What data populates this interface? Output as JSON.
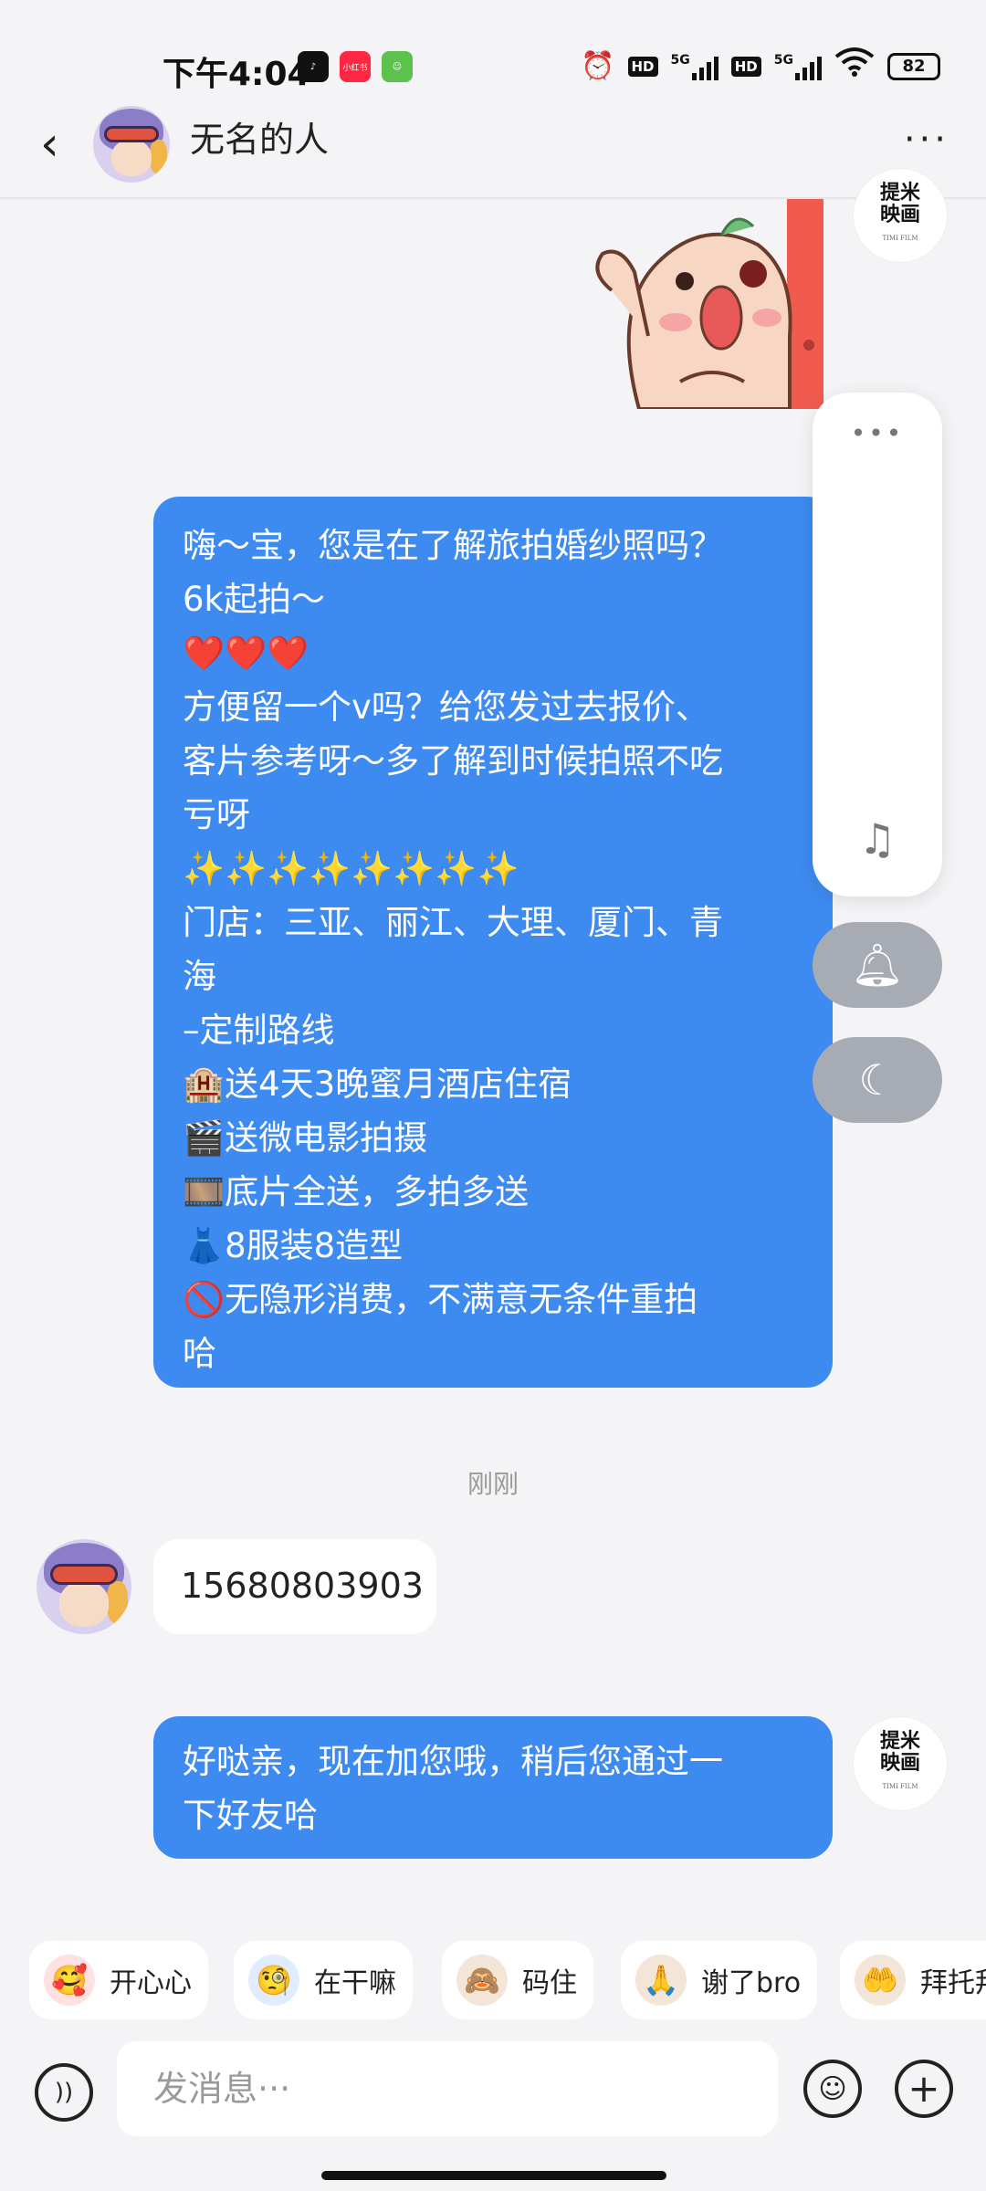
{
  "status_bar": {
    "time": "下午4:04",
    "app_icons": [
      "tiktok-icon",
      "xiaohongshu-icon",
      "android-app-icon"
    ],
    "xiaohongshu_label": "小红书",
    "hd_label_1": "HD",
    "net_1": "5G",
    "hd_label_2": "HD",
    "net_2": "5G",
    "battery": "82"
  },
  "header": {
    "contact_name": "无名的人"
  },
  "brand_avatar": {
    "line1": "提米",
    "line2": "映画",
    "small": "TIMI FILM"
  },
  "messages": [
    {
      "side": "me",
      "text": "嗨～宝，您是在了解旅拍婚纱照吗？\n6k起拍～\n❤️❤️❤️\n方便留一个v吗？给您发过去报价、\n客片参考呀～多了解到时候拍照不吃\n亏呀\n✨✨✨✨✨✨✨✨\n门店：三亚、丽江、大理、厦门、青\n海\n–定制路线\n🏨送4天3晚蜜月酒店住宿\n🎬送微电影拍摄\n🎞️底片全送，多拍多送\n👗8服装8造型\n🚫无隐形消费，不满意无条件重拍\n哈"
    },
    {
      "side": "them",
      "text": "15680803903"
    },
    {
      "side": "me",
      "text": "好哒亲，现在加您哦，稍后您通过一\n下好友哈"
    }
  ],
  "timestamp": "刚刚",
  "quick_replies": [
    {
      "label": "开心心",
      "emoji": "🥰"
    },
    {
      "label": "在干嘛",
      "emoji": "🧐"
    },
    {
      "label": "码住",
      "emoji": "🙈"
    },
    {
      "label": "谢了bro",
      "emoji": "🙏"
    },
    {
      "label": "拜托拜",
      "emoji": "🤲"
    }
  ],
  "input": {
    "placeholder": "发消息···"
  },
  "colors": {
    "bubble_me": "#3d8af0",
    "bubble_them": "#ffffff",
    "background": "#f4f4f6",
    "float_button": "#a7abb3"
  }
}
